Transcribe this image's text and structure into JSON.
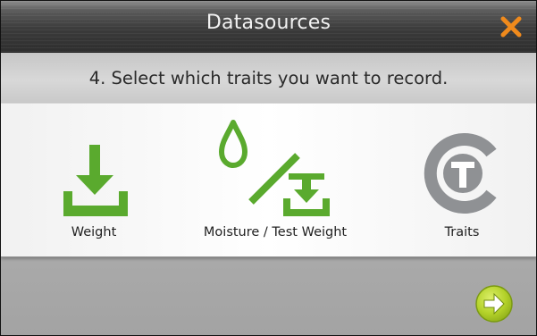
{
  "window": {
    "title": "Datasources"
  },
  "instruction": "4. Select which traits you want to record.",
  "options": [
    {
      "label": "Weight",
      "icon": "download-tray-icon"
    },
    {
      "label": "Moisture / Test Weight",
      "icon": "droplet-slash-tray-icon"
    },
    {
      "label": "Traits",
      "icon": "traits-logo-icon"
    }
  ],
  "colors": {
    "accent_green": "#5aaa2e",
    "close_orange": "#f08a1c",
    "next_lime": "#b9d42a",
    "traits_gray": "#8f9194"
  }
}
